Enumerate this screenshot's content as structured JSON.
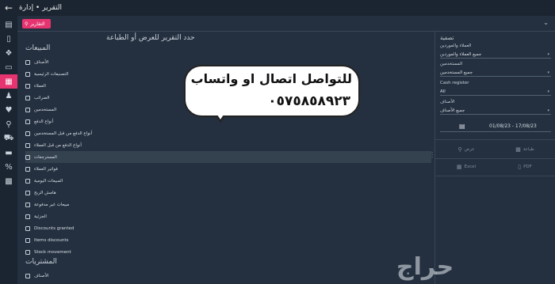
{
  "titlebar": {
    "back_icon": "arrow-left-icon",
    "breadcrumb": "التقرير • إدارة"
  },
  "search": {
    "chip_label": "التقارير"
  },
  "rail": {
    "icons": [
      "dashboard-icon",
      "document-icon",
      "tag-icon",
      "archive-icon",
      "reports-icon",
      "users-icon",
      "heart-icon",
      "key-icon",
      "truck-icon",
      "card-icon",
      "percent-icon",
      "box-icon"
    ],
    "active_index": 4
  },
  "main": {
    "title": "حدد التقرير للعرض أو الطباعة",
    "sections": [
      {
        "heading": "المبيعات",
        "items": [
          "الأصناف",
          "التصنيفات الرئيسية",
          "العملاء",
          "الضرائب",
          "المستخدمين",
          "أنواع الدفع",
          "أنواع الدفع من قبل المستخدمين",
          "أنواع الدفع من قبل العملاء",
          "المسترجعات",
          "فواتير العملاء",
          "المبيعات اليومية",
          "هامش الربح",
          "مبيعات غير مدفوعة",
          "الجزئية",
          "Discounts granted",
          "Items discounts",
          "Stock movement"
        ],
        "selected_index": 8
      },
      {
        "heading": "المشتريات",
        "items": [
          "الأصناف"
        ]
      }
    ]
  },
  "filters": {
    "title": "تصفية",
    "customers_label": "العملاء والموردين",
    "customers_value": "جميع العملاء والموردين",
    "users_label": "المستخدمين",
    "users_value": "جميع المستخدمين",
    "register_label": "Cash register",
    "register_value": "All",
    "products_label": "الأصناف",
    "products_value": "جميع الأصناف",
    "date_range": "01/08/23 - 17/08/23"
  },
  "actions": {
    "show_label": "عرض",
    "print_label": "طباعة",
    "excel_label": "Excel",
    "pdf_label": "PDF"
  },
  "watermark": {
    "contact_line": "للتواصل اتصال او واتساب",
    "phone": "٠٥٧٥٨٥٨٩٢٣",
    "brand": "حراج"
  }
}
